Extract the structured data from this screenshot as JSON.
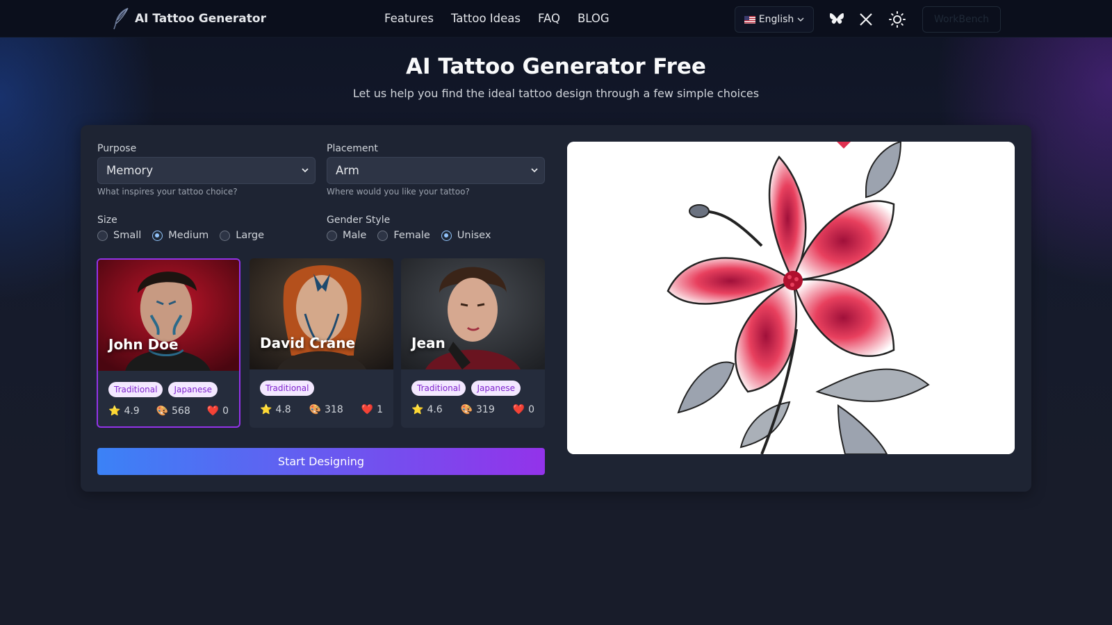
{
  "nav": {
    "brand": "AI Tattoo Generator",
    "links": [
      "Features",
      "Tattoo Ideas",
      "FAQ",
      "BLOG"
    ],
    "language": "English",
    "workbench": "WorkBench"
  },
  "hero": {
    "title": "AI Tattoo Generator Free",
    "subtitle": "Let us help you find the ideal tattoo design through a few simple choices"
  },
  "form": {
    "purpose": {
      "label": "Purpose",
      "value": "Memory",
      "hint": "What inspires your tattoo choice?"
    },
    "placement": {
      "label": "Placement",
      "value": "Arm",
      "hint": "Where would you like your tattoo?"
    },
    "size": {
      "label": "Size",
      "options": [
        "Small",
        "Medium",
        "Large"
      ],
      "selected": "Medium"
    },
    "gender": {
      "label": "Gender Style",
      "options": [
        "Male",
        "Female",
        "Unisex"
      ],
      "selected": "Unisex"
    }
  },
  "artists": [
    {
      "name": "John Doe",
      "tags": [
        "Traditional",
        "Japanese"
      ],
      "rating": "4.9",
      "works": "568",
      "likes": "0",
      "selected": true
    },
    {
      "name": "David Crane",
      "tags": [
        "Traditional"
      ],
      "rating": "4.8",
      "works": "318",
      "likes": "1",
      "selected": false
    },
    {
      "name": "Jean",
      "tags": [
        "Traditional",
        "Japanese"
      ],
      "rating": "4.6",
      "works": "319",
      "likes": "0",
      "selected": false
    }
  ],
  "start_button": "Start Designing",
  "colors": {
    "accent_start": "#3b82f6",
    "accent_end": "#9333ea",
    "tag_bg": "#f3e8ff",
    "tag_text": "#7e22ce"
  },
  "icons": {
    "logo": "feather-pen-icon",
    "bluesky": "butterfly-icon",
    "x": "x-logo-icon",
    "theme": "sun-icon",
    "rating": "star-icon",
    "works": "palette-icon",
    "likes": "heart-icon"
  }
}
